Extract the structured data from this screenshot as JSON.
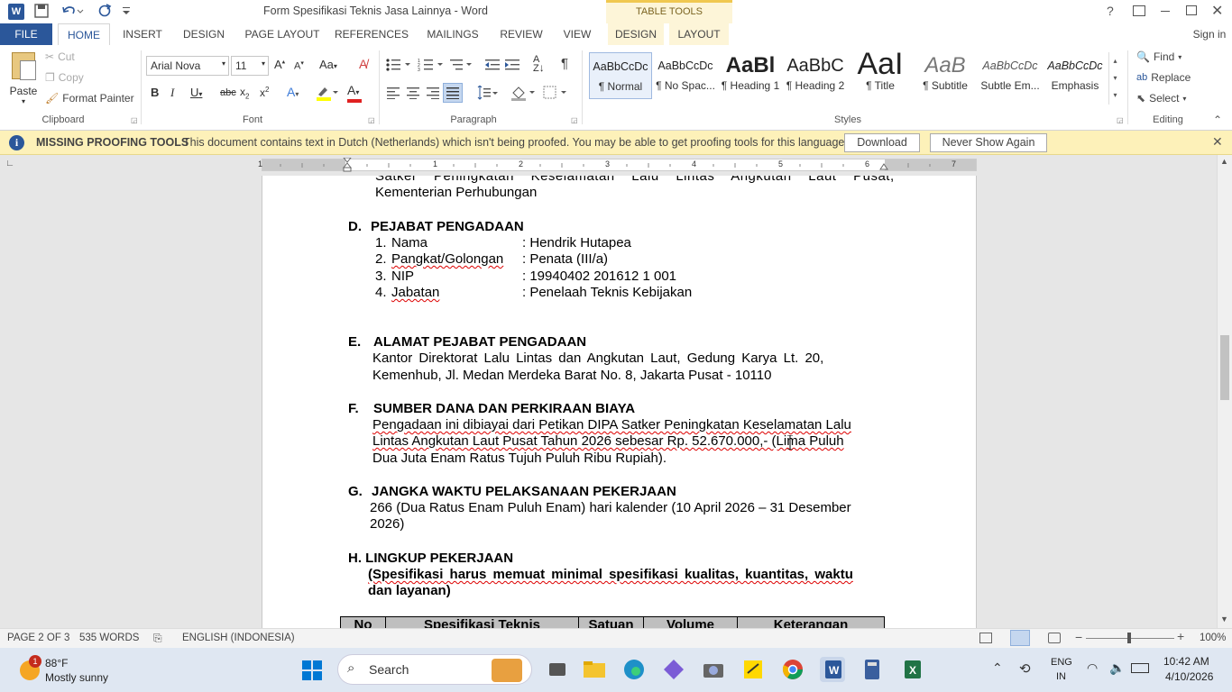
{
  "window": {
    "title": "Form Spesifikasi Teknis Jasa Lainnya - Word",
    "context_tab_group": "TABLE TOOLS",
    "sign_in": "Sign in"
  },
  "ribbon_tabs": [
    "FILE",
    "HOME",
    "INSERT",
    "DESIGN",
    "PAGE LAYOUT",
    "REFERENCES",
    "MAILINGS",
    "REVIEW",
    "VIEW",
    "DESIGN",
    "LAYOUT"
  ],
  "clipboard": {
    "paste": "Paste",
    "cut": "Cut",
    "copy": "Copy",
    "format_painter": "Format Painter",
    "label": "Clipboard"
  },
  "font": {
    "name": "Arial Nova",
    "size": "11",
    "label": "Font"
  },
  "paragraph": {
    "label": "Paragraph"
  },
  "styles": {
    "items": [
      {
        "preview": "AaBbCcDc",
        "name": "¶ Normal"
      },
      {
        "preview": "AaBbCcDc",
        "name": "¶ No Spac..."
      },
      {
        "preview": "AaBl",
        "name": "¶ Heading 1"
      },
      {
        "preview": "AaBbC",
        "name": "¶ Heading 2"
      },
      {
        "preview": "AaI",
        "name": "¶ Title"
      },
      {
        "preview": "AaB",
        "name": "¶ Subtitle"
      },
      {
        "preview": "AaBbCcDc",
        "name": "Subtle Em..."
      },
      {
        "preview": "AaBbCcDc",
        "name": "Emphasis"
      }
    ],
    "label": "Styles"
  },
  "editing": {
    "find": "Find",
    "replace": "Replace",
    "select": "Select",
    "label": "Editing"
  },
  "message_bar": {
    "title": "MISSING PROOFING TOOLS",
    "text": "This document contains text in Dutch (Netherlands) which isn't being proofed. You may be able to get proofing tools for this language.",
    "download": "Download",
    "never": "Never Show Again"
  },
  "ruler": {
    "numbers": [
      "1",
      "1",
      "2",
      "3",
      "4",
      "5",
      "6",
      "7"
    ]
  },
  "document": {
    "l_satker": "Satker Peningkatan Keselamatan Lalu Lintas Angkutan Laut Pusat,",
    "l_kemen": "Kementerian Perhubungan",
    "d_letter": "D.",
    "d_title": "PEJABAT PENGADAAN",
    "items": [
      {
        "num": "1.",
        "label": "Nama",
        "value": ": Hendrik Hutapea"
      },
      {
        "num": "2.",
        "label": "Pangkat/Golongan",
        "value": ": Penata (III/a)"
      },
      {
        "num": "3.",
        "label": "NIP",
        "value": ": 19940402 201612 1 001"
      },
      {
        "num": "4.",
        "label": "Jabatan",
        "value": ": Penelaah Teknis Kebijakan"
      }
    ],
    "e_letter": "E.",
    "e_title": "ALAMAT PEJABAT PENGADAAN",
    "e_line1": "Kantor Direktorat Lalu Lintas dan Angkutan Laut, Gedung Karya Lt. 20,",
    "e_line2": "Kemenhub, Jl. Medan Merdeka Barat No. 8, Jakarta Pusat - 10110",
    "f_letter": "F.",
    "f_title": "SUMBER DANA DAN PERKIRAAN BIAYA",
    "f_line1": "Pengadaan ini dibiayai dari Petikan DIPA Satker Peningkatan Keselamatan Lalu",
    "f_line2": "Lintas Angkutan Laut Pusat Tahun 2026  sebesar Rp. 52.670.000,- (Lima Puluh",
    "f_line3": "Dua Juta Enam Ratus Tujuh Puluh Ribu Rupiah).",
    "g_letter": "G.",
    "g_title": "JANGKA WAKTU PELAKSANAAN PEKERJAAN",
    "g_line1": "266 (Dua Ratus Enam Puluh Enam) hari kalender (10 April 2026 – 31 Desember",
    "g_line2": "2026)",
    "h_title": "H. LINGKUP PEKERJAAN",
    "h_line1": "(Spesifikasi harus memuat minimal spesifikasi kualitas, kuantitas, waktu",
    "h_line2": "dan layanan)",
    "table_headers": [
      "No",
      "Spesifikasi Teknis",
      "Satuan",
      "Volume",
      "Keterangan"
    ]
  },
  "status": {
    "page": "PAGE 2 OF 3",
    "words": "535 WORDS",
    "language": "ENGLISH (INDONESIA)",
    "zoom": "100%"
  },
  "taskbar": {
    "temp": "88°F",
    "weather": "Mostly sunny",
    "badge": "1",
    "search": "Search",
    "lang1": "ENG",
    "lang2": "IN",
    "time": "10:42 AM",
    "date": "4/10/2026"
  },
  "colors": {
    "accent": "#2b579a",
    "msgbar": "#fdf1b9",
    "taskbar": "#dfe7f2"
  }
}
